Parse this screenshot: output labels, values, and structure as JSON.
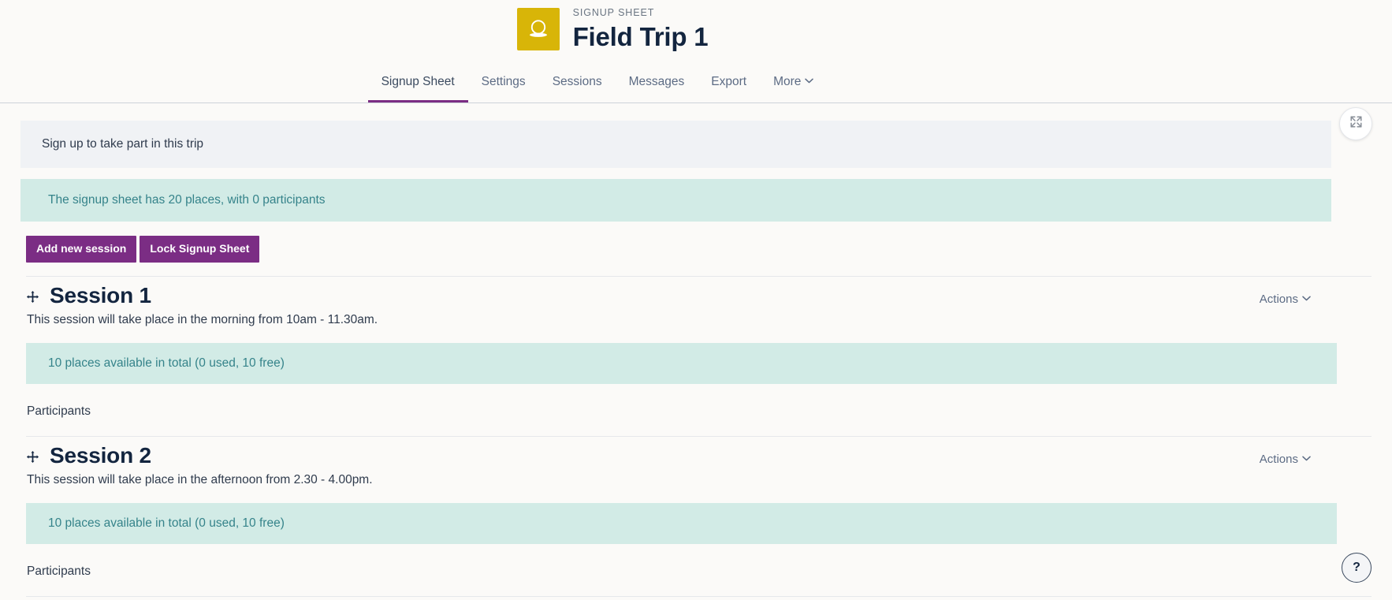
{
  "header": {
    "icon_name": "signup-sheet-icon",
    "icon_color": "#d8b508",
    "eyebrow": "SIGNUP SHEET",
    "title": "Field Trip 1"
  },
  "nav": {
    "tabs": [
      {
        "label": "Signup Sheet",
        "active": true
      },
      {
        "label": "Settings",
        "active": false
      },
      {
        "label": "Sessions",
        "active": false
      },
      {
        "label": "Messages",
        "active": false
      },
      {
        "label": "Export",
        "active": false
      },
      {
        "label": "More",
        "active": false,
        "has_caret": true
      }
    ],
    "active_accent": "#7b2d84"
  },
  "main": {
    "instruction": "Sign up to take part in this trip",
    "expand_icon_name": "expand-arrows-icon",
    "summary": "The signup sheet has 20 places, with 0 participants",
    "summary_bg": "#d2ebe6",
    "summary_fg": "#35838a",
    "buttons": [
      {
        "label": "Add new session"
      },
      {
        "label": "Lock Signup Sheet"
      }
    ],
    "button_color": "#7b2d84",
    "actions_label": "Actions",
    "participants_label": "Participants",
    "sessions": [
      {
        "title": "Session 1",
        "description": "This session will take place in the morning from 10am - 11.30am.",
        "places": "10 places available in total (0 used, 10 free)"
      },
      {
        "title": "Session 2",
        "description": "This session will take place in the afternoon from 2.30 - 4.00pm.",
        "places": "10 places available in total (0 used, 10 free)"
      }
    ]
  },
  "help": {
    "label": "?"
  }
}
